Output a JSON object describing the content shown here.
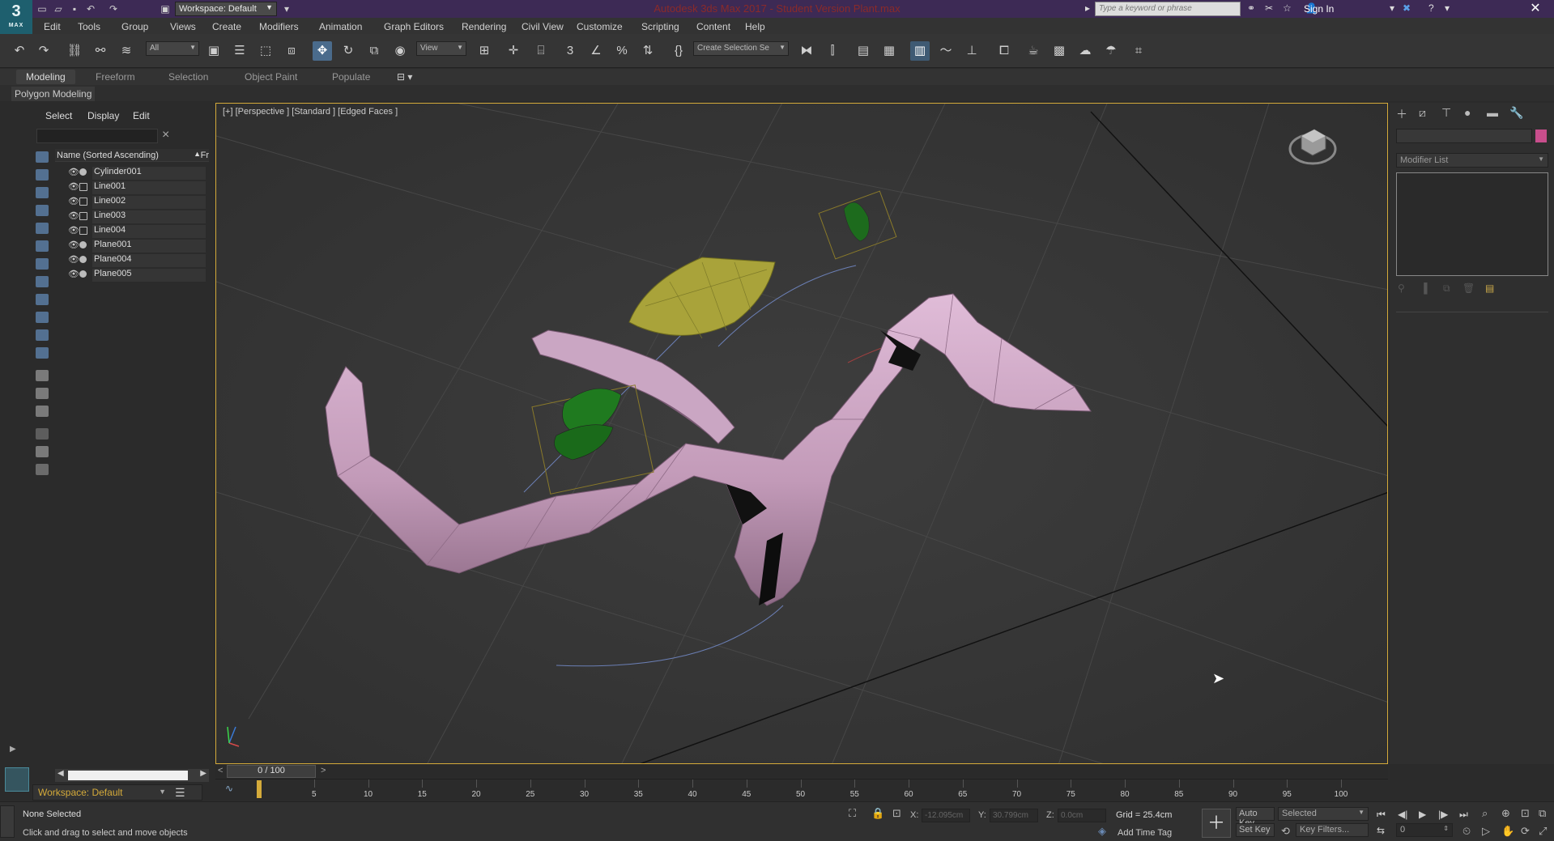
{
  "title_bar": {
    "app_title": "Autodesk 3ds Max 2017 - Student Version    Plant.max",
    "workspace": "Workspace: Default",
    "search_placeholder": "Type a keyword or phrase",
    "sign_in": "Sign In",
    "logo_number": "3",
    "logo_text": "MAX"
  },
  "menu": [
    "Edit",
    "Tools",
    "Group",
    "Views",
    "Create",
    "Modifiers",
    "Animation",
    "Graph Editors",
    "Rendering",
    "Civil View",
    "Customize",
    "Scripting",
    "Content",
    "Help"
  ],
  "toolbar": {
    "filter": "All",
    "ref_coord": "View",
    "named_selection": "Create Selection Se"
  },
  "ribbon": {
    "tabs": [
      "Modeling",
      "Freeform",
      "Selection",
      "Object Paint",
      "Populate"
    ],
    "active_tab": "Modeling",
    "panel_label": "Polygon Modeling"
  },
  "scene_explorer": {
    "menu": [
      "Select",
      "Display",
      "Edit"
    ],
    "column_header": "Name (Sorted Ascending)",
    "column_frozen": "Fr",
    "objects": [
      {
        "name": "Cylinder001",
        "type": "geometry"
      },
      {
        "name": "Line001",
        "type": "shape"
      },
      {
        "name": "Line002",
        "type": "shape"
      },
      {
        "name": "Line003",
        "type": "shape"
      },
      {
        "name": "Line004",
        "type": "shape"
      },
      {
        "name": "Plane001",
        "type": "geometry"
      },
      {
        "name": "Plane004",
        "type": "geometry"
      },
      {
        "name": "Plane005",
        "type": "geometry"
      }
    ],
    "workspace": "Workspace: Default"
  },
  "viewport": {
    "label": "[+] [Perspective ] [Standard ] [Edged Faces ]"
  },
  "command_panel": {
    "modifier_list": "Modifier List",
    "object_color": "#c84e8c"
  },
  "timeline": {
    "slider": "0 / 100",
    "ticks": [
      "5",
      "10",
      "15",
      "20",
      "25",
      "30",
      "35",
      "40",
      "45",
      "50",
      "55",
      "60",
      "65",
      "70",
      "75",
      "80",
      "85",
      "90",
      "95",
      "100"
    ]
  },
  "status": {
    "selection": "None Selected",
    "hint": "Click and drag to select and move objects",
    "x_label": "X:",
    "x_value": "-12.095cm",
    "y_label": "Y:",
    "y_value": "30.799cm",
    "z_label": "Z:",
    "z_value": "0.0cm",
    "grid": "Grid = 25.4cm",
    "add_time_tag": "Add Time Tag",
    "auto_key": "Auto Key",
    "set_key": "Set Key",
    "selected": "Selected",
    "key_filters": "Key Filters...",
    "frame": "0"
  },
  "colors": {
    "title_bar": "#3d2a55",
    "accent_gold": "#d4aa3a",
    "tube_pink": "#c9a0c2",
    "leaf_green": "#1f7a1f",
    "leaf_yellow": "#a8a035"
  }
}
